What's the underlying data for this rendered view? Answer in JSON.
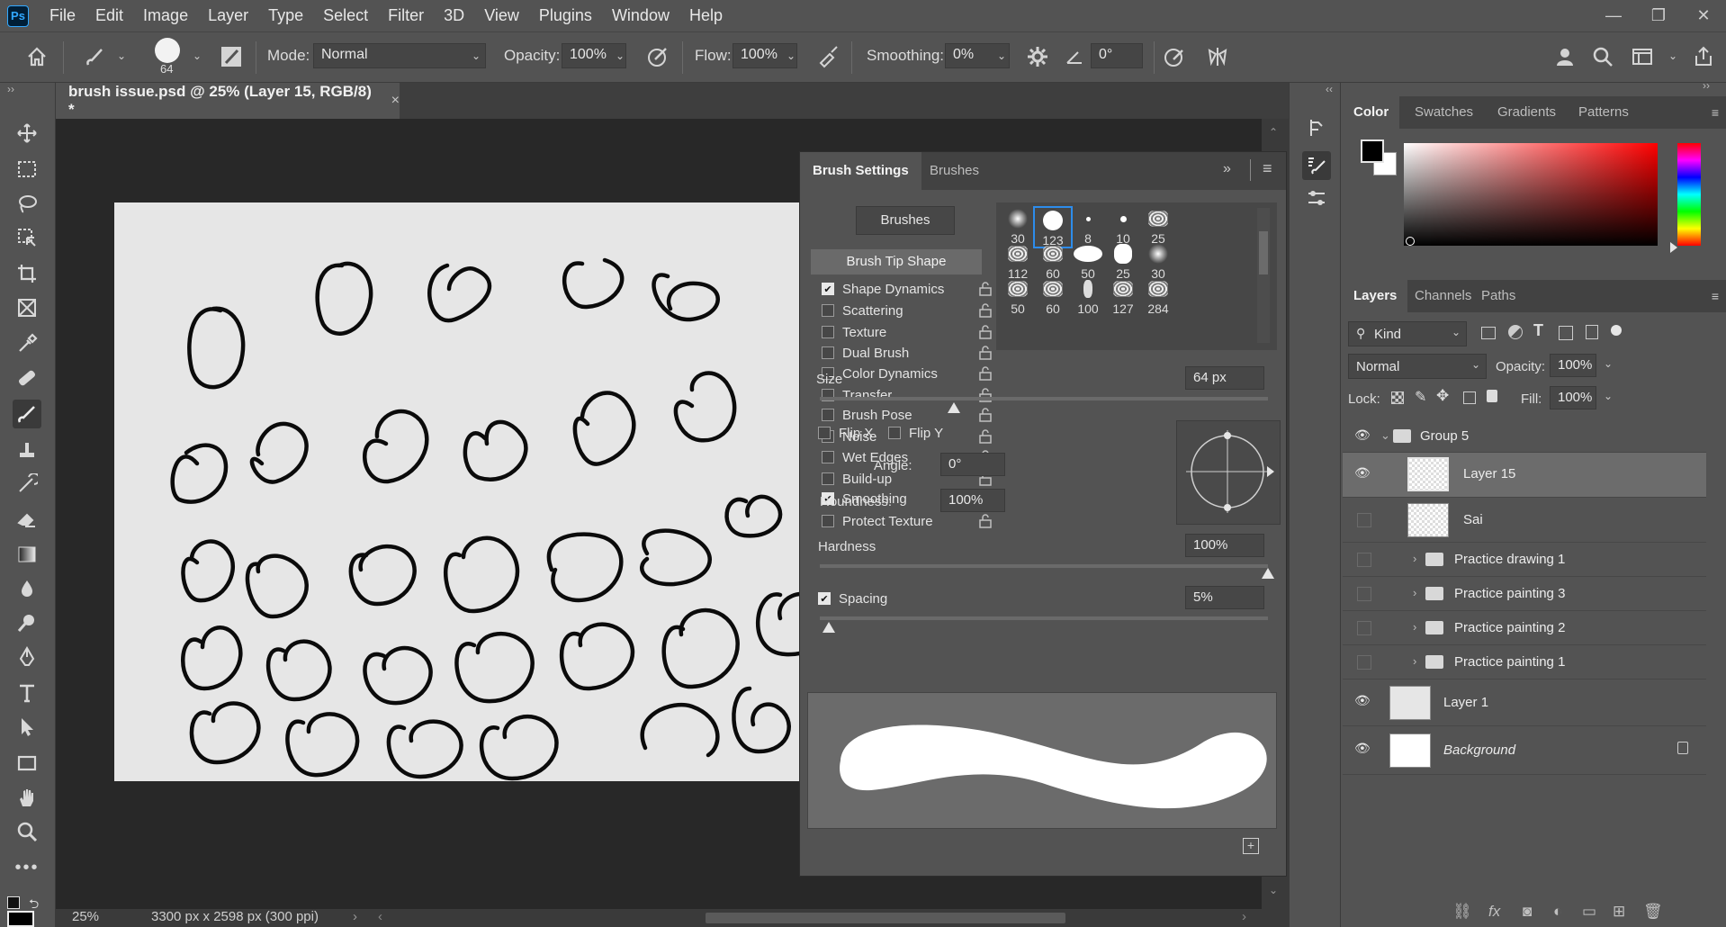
{
  "app": {
    "logo": "Ps"
  },
  "menu": [
    "File",
    "Edit",
    "Image",
    "Layer",
    "Type",
    "Select",
    "Filter",
    "3D",
    "View",
    "Plugins",
    "Window",
    "Help"
  ],
  "window_controls": {
    "minimize": "—",
    "restore": "❐",
    "close": "✕"
  },
  "options": {
    "brush_size": "64",
    "mode_label": "Mode:",
    "mode_value": "Normal",
    "opacity_label": "Opacity:",
    "opacity_value": "100%",
    "flow_label": "Flow:",
    "flow_value": "100%",
    "smoothing_label": "Smoothing:",
    "smoothing_value": "0%",
    "angle_value": "0°"
  },
  "document": {
    "tab_title": "brush issue.psd @ 25% (Layer 15, RGB/8) *",
    "close": "×",
    "zoom": "25%",
    "doc_info": "3300 px x 2598 px (300 ppi)"
  },
  "brush_settings": {
    "tab_settings": "Brush Settings",
    "tab_brushes": "Brushes",
    "brushes_button": "Brushes",
    "tip_shape_label": "Brush Tip Shape",
    "options": [
      {
        "label": "Shape Dynamics",
        "checked": true
      },
      {
        "label": "Scattering",
        "checked": false
      },
      {
        "label": "Texture",
        "checked": false
      },
      {
        "label": "Dual Brush",
        "checked": false
      },
      {
        "label": "Color Dynamics",
        "checked": false
      },
      {
        "label": "Transfer",
        "checked": false
      },
      {
        "label": "Brush Pose",
        "checked": false
      },
      {
        "label": "Noise",
        "checked": false
      },
      {
        "label": "Wet Edges",
        "checked": false
      },
      {
        "label": "Build-up",
        "checked": false
      },
      {
        "label": "Smoothing",
        "checked": true
      },
      {
        "label": "Protect Texture",
        "checked": false
      }
    ],
    "tips": [
      "30",
      "123",
      "8",
      "10",
      "25",
      "112",
      "60",
      "50",
      "25",
      "30",
      "50",
      "60",
      "100",
      "127",
      "284"
    ],
    "selected_tip": "123",
    "size_label": "Size",
    "size_value": "64 px",
    "flip_x": "Flip X",
    "flip_y": "Flip Y",
    "angle_label": "Angle:",
    "angle_value": "0°",
    "roundness_label": "Roundness:",
    "roundness_value": "100%",
    "hardness_label": "Hardness",
    "hardness_value": "100%",
    "spacing_label": "Spacing",
    "spacing_value": "5%",
    "spacing_checked": true,
    "size_level": 0.3,
    "hardness_level": 1.0,
    "spacing_level": 0.02
  },
  "color_panel": {
    "tabs": [
      "Color",
      "Swatches",
      "Gradients",
      "Patterns"
    ],
    "foreground": "#000000",
    "background": "#ffffff",
    "hue": "#ff0000"
  },
  "layers_panel": {
    "tabs": [
      "Layers",
      "Channels",
      "Paths"
    ],
    "filter_kind": "Kind",
    "blend_mode": "Normal",
    "opacity_label": "Opacity:",
    "opacity_value": "100%",
    "lock_label": "Lock:",
    "fill_label": "Fill:",
    "fill_value": "100%",
    "layers": [
      {
        "name": "Group 5",
        "type": "group-open",
        "visible": true
      },
      {
        "name": "Layer 15",
        "type": "layer",
        "visible": true,
        "selected": true
      },
      {
        "name": "Sai",
        "type": "layer",
        "visible": false
      },
      {
        "name": "Practice drawing 1",
        "type": "group",
        "visible": false
      },
      {
        "name": "Practice painting 3",
        "type": "group",
        "visible": false
      },
      {
        "name": "Practice painting 2",
        "type": "group",
        "visible": false
      },
      {
        "name": "Practice painting 1",
        "type": "group",
        "visible": false
      },
      {
        "name": "Layer 1",
        "type": "layer",
        "visible": true
      },
      {
        "name": "Background",
        "type": "background",
        "visible": true,
        "locked": true
      }
    ]
  },
  "colors": {
    "ui_bg": "#535353",
    "canvas_bg": "#282828",
    "artboard": "#e6e6e6",
    "accent_blue": "#2d8ceb"
  }
}
